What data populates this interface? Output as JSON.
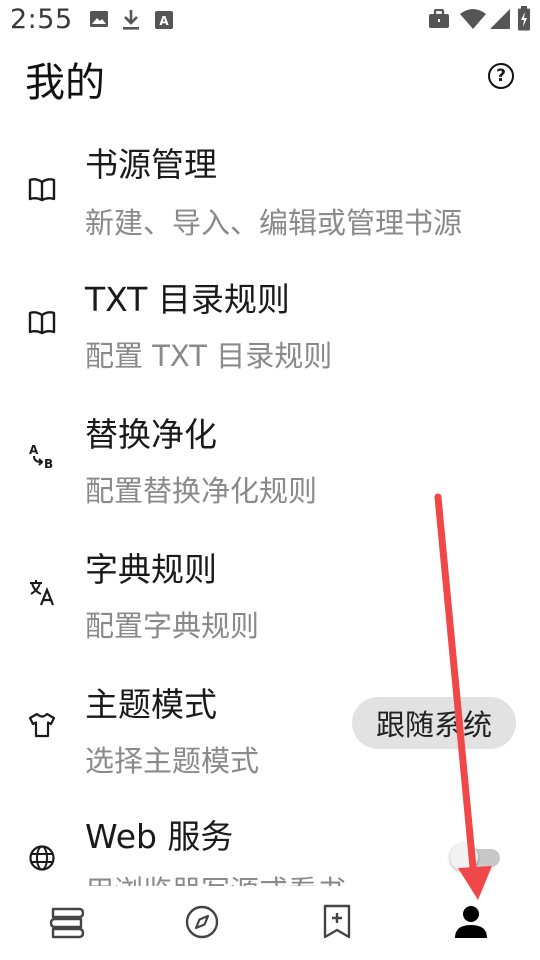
{
  "status_bar": {
    "time": "2:55",
    "icons": [
      "image-icon",
      "download-icon",
      "text-a-icon",
      "briefcase-icon",
      "wifi-icon",
      "signal-icon",
      "battery-charging-icon"
    ]
  },
  "app_bar": {
    "title": "我的",
    "help_icon": "help-circle-icon"
  },
  "list": [
    {
      "icon": "book-icon",
      "title": "书源管理",
      "subtitle": "新建、导入、编辑或管理书源"
    },
    {
      "icon": "book-icon",
      "title": "TXT 目录规则",
      "subtitle": "配置 TXT 目录规则"
    },
    {
      "icon": "replace-ab-icon",
      "title": "替换净化",
      "subtitle": "配置替换净化规则"
    },
    {
      "icon": "translate-icon",
      "title": "字典规则",
      "subtitle": "配置字典规则"
    },
    {
      "icon": "tshirt-icon",
      "title": "主题模式",
      "subtitle": "选择主题模式",
      "value": "跟随系统"
    },
    {
      "icon": "globe-icon",
      "title": "Web 服务",
      "subtitle": "用浏览器写源或看书",
      "toggle_on": false
    }
  ],
  "bottom_nav": [
    {
      "icon": "bookshelf-icon",
      "selected": false
    },
    {
      "icon": "compass-icon",
      "selected": false
    },
    {
      "icon": "bookmark-add-icon",
      "selected": false
    },
    {
      "icon": "person-icon",
      "selected": true
    }
  ],
  "annotation": {
    "type": "arrow",
    "color": "#f04848",
    "target": "person-icon"
  }
}
